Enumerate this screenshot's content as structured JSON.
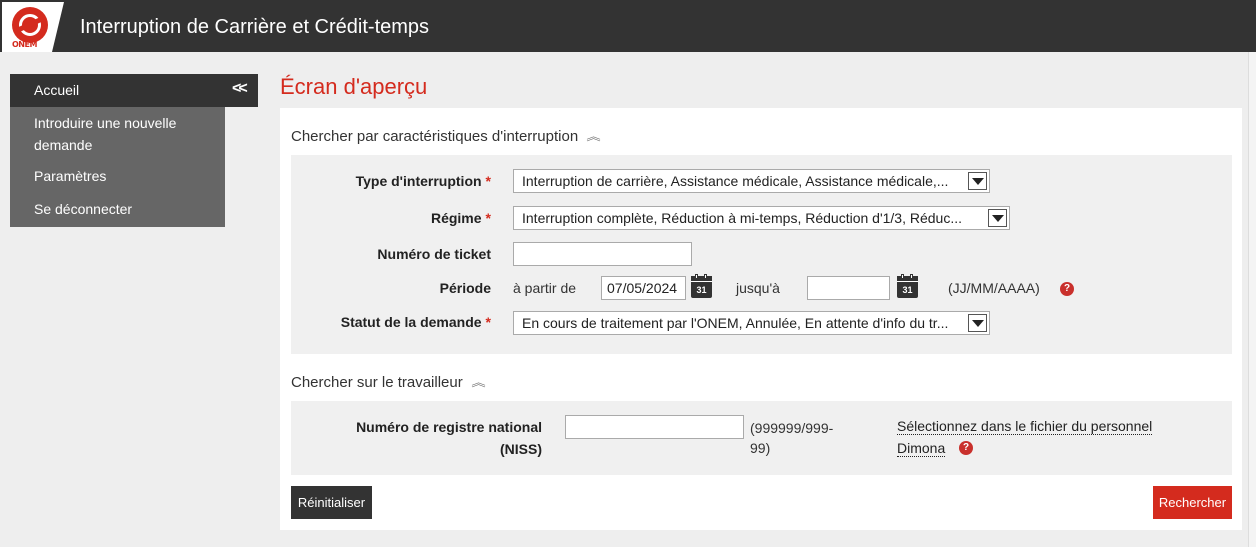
{
  "header": {
    "logo_text": "ONEM",
    "title": "Interruption de Carrière et Crédit-temps"
  },
  "sidebar": {
    "collapse_glyph": "<<",
    "items": [
      {
        "label": "Accueil",
        "active": true
      },
      {
        "label": "Introduire une nouvelle"
      },
      {
        "label": "demande"
      },
      {
        "label": "Paramètres"
      },
      {
        "label": "Se déconnecter"
      }
    ]
  },
  "page": {
    "title": "Écran d'aperçu"
  },
  "section1": {
    "title": "Chercher par caractéristiques d'interruption",
    "type_interruption": {
      "label": "Type d'interruption",
      "required": "*",
      "value": "Interruption de carrière, Assistance médicale, Assistance médicale,..."
    },
    "regime": {
      "label": "Régime",
      "required": "*",
      "value": "Interruption complète, Réduction à mi-temps, Réduction d'1/3, Réduc..."
    },
    "ticket": {
      "label": "Numéro de ticket",
      "value": ""
    },
    "periode": {
      "label": "Période",
      "from_label": "à partir de",
      "from_value": "07/05/2024",
      "to_label": "jusqu'à",
      "to_value": "",
      "calendar_day": "31",
      "format_hint": "(JJ/MM/AAAA)",
      "help": "?"
    },
    "statut": {
      "label": "Statut de la demande",
      "required": "*",
      "value": "En cours de traitement par l'ONEM, Annulée, En attente d'info du tr..."
    }
  },
  "section2": {
    "title": "Chercher sur le travailleur",
    "niss": {
      "label_line1": "Numéro de registre national",
      "label_line2": "(NISS)",
      "value": "",
      "hint_line1": "(999999/999-",
      "hint_line2": "99)"
    },
    "dimona_link_line1": "Sélectionnez dans le fichier du personnel",
    "dimona_link_line2": "Dimona",
    "help": "?"
  },
  "buttons": {
    "reset": "Réinitialiser",
    "search": "Rechercher"
  },
  "colors": {
    "brand_red": "#d42b1e",
    "header_dark": "#333333",
    "sidebar_gray": "#666666"
  }
}
